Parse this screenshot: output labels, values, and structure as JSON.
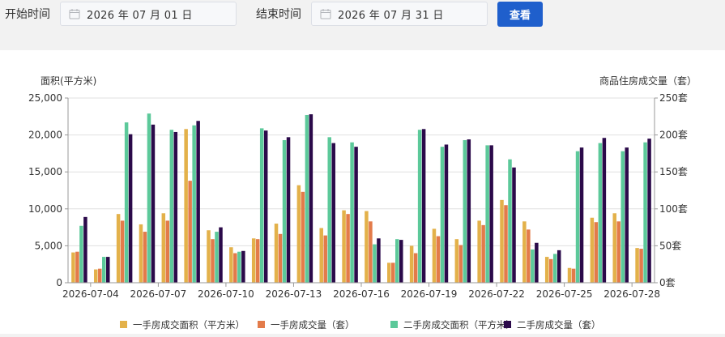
{
  "filters": {
    "start_label": "开始时间",
    "start_value": "2026 年 07 月 01 日",
    "end_label": "结束时间",
    "end_value": "2026 年 07 月 31 日",
    "query_label": "查看"
  },
  "colors": {
    "s1": "#e3b14a",
    "s2": "#e37b4a",
    "s3": "#5cc99a",
    "s4": "#2b0a4a",
    "axis": "#999999",
    "grid": "#e0e0e0",
    "button": "#1f5fcc"
  },
  "chart_data": {
    "type": "bar",
    "left_axis_title": "面积(平方米)",
    "right_axis_title": "商品住房成交量（套）",
    "left_ylim": [
      0,
      25000
    ],
    "left_ticks": [
      "0",
      "5,000",
      "10,000",
      "15,000",
      "20,000",
      "25,000"
    ],
    "right_ylim": [
      0,
      250
    ],
    "right_ticks": [
      "0套",
      "50套",
      "100套",
      "150套",
      "200套",
      "250套"
    ],
    "grid": true,
    "legend_position": "bottom",
    "x_tick_labels": [
      "2026-07-04",
      "2026-07-07",
      "2026-07-10",
      "2026-07-13",
      "2026-07-16",
      "2026-07-19",
      "2026-07-22",
      "2026-07-25",
      "2026-07-28"
    ],
    "categories": [
      "2026-07-03",
      "2026-07-04",
      "2026-07-05",
      "2026-07-06",
      "2026-07-07",
      "2026-07-08",
      "2026-07-09",
      "2026-07-10",
      "2026-07-11",
      "2026-07-12",
      "2026-07-13",
      "2026-07-14",
      "2026-07-15",
      "2026-07-16",
      "2026-07-17",
      "2026-07-18",
      "2026-07-19",
      "2026-07-20",
      "2026-07-21",
      "2026-07-22",
      "2026-07-23",
      "2026-07-24",
      "2026-07-25",
      "2026-07-26",
      "2026-07-27",
      "2026-07-28"
    ],
    "series": [
      {
        "name": "一手房成交面积（平方米）",
        "axis": "left",
        "values": [
          4100,
          1800,
          9300,
          7900,
          9400,
          20800,
          7100,
          4800,
          6000,
          8000,
          13200,
          7400,
          9800,
          9700,
          2700,
          5000,
          7300,
          5900,
          8400,
          11200,
          8300,
          3500,
          2000,
          8800,
          9400,
          4700
        ]
      },
      {
        "name": "一手房成交量（套）",
        "axis": "right",
        "values": [
          42,
          19,
          84,
          69,
          84,
          138,
          59,
          40,
          59,
          66,
          123,
          64,
          93,
          83,
          27,
          40,
          63,
          51,
          78,
          105,
          72,
          32,
          19,
          82,
          83,
          46
        ]
      },
      {
        "name": "二手房成交面积（平方米）",
        "axis": "left",
        "values": [
          7700,
          3500,
          21700,
          22900,
          20700,
          21300,
          6900,
          4200,
          20900,
          19300,
          22700,
          19700,
          19000,
          5200,
          5900,
          20700,
          18400,
          19300,
          18600,
          16700,
          4500,
          3900,
          17800,
          18900,
          17800,
          19000
        ]
      },
      {
        "name": "二手房成交量（套）",
        "axis": "right",
        "values": [
          89,
          35,
          201,
          214,
          204,
          219,
          75,
          43,
          206,
          197,
          228,
          189,
          184,
          60,
          58,
          208,
          187,
          194,
          186,
          156,
          54,
          44,
          183,
          196,
          183,
          195
        ]
      }
    ]
  }
}
